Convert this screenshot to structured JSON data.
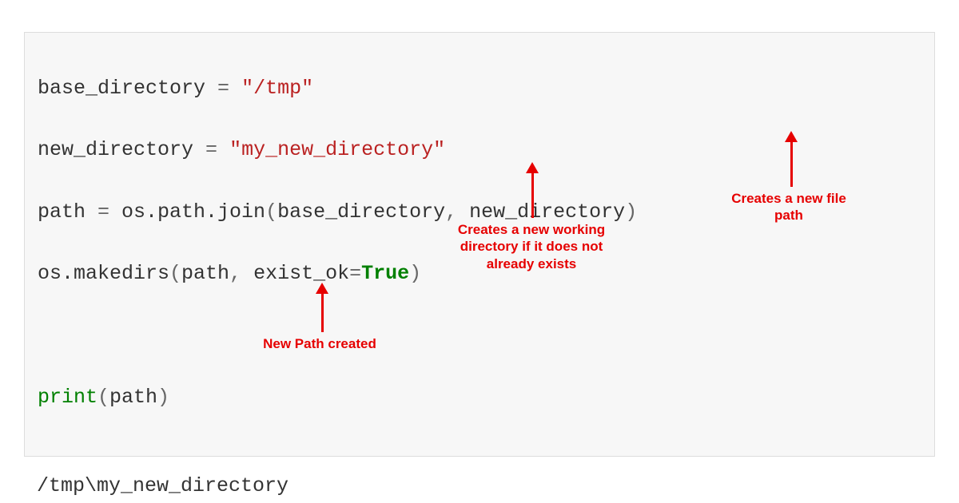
{
  "code": {
    "line1": {
      "var": "base_directory",
      "op": " = ",
      "str": "\"/tmp\""
    },
    "line2": {
      "var": "new_directory",
      "op": " = ",
      "str": "\"my_new_directory\""
    },
    "line3": {
      "var": "path",
      "op": " = ",
      "fn": "os.path.join",
      "paren_open": "(",
      "arg1": "base_directory",
      "comma": ", ",
      "arg2": "new_directory",
      "paren_close": ")"
    },
    "line4": {
      "fn": "os.makedirs",
      "paren_open": "(",
      "arg1": "path",
      "comma": ", ",
      "kwarg": "exist_ok",
      "eq": "=",
      "val": "True",
      "paren_close": ")"
    },
    "blank": " ",
    "line5": {
      "fn": "print",
      "paren_open": "(",
      "arg": "path",
      "paren_close": ")"
    }
  },
  "output": "/tmp\\my_new_directory",
  "annotations": {
    "makedirs": "Creates a new working directory if it does not already exists",
    "join": "Creates a new file path",
    "output": "New Path created"
  },
  "colors": {
    "annotation": "#e60000",
    "string": "#ba2121",
    "keyword": "#008000",
    "code_bg": "#f7f7f7",
    "code_border": "#dddddd"
  }
}
